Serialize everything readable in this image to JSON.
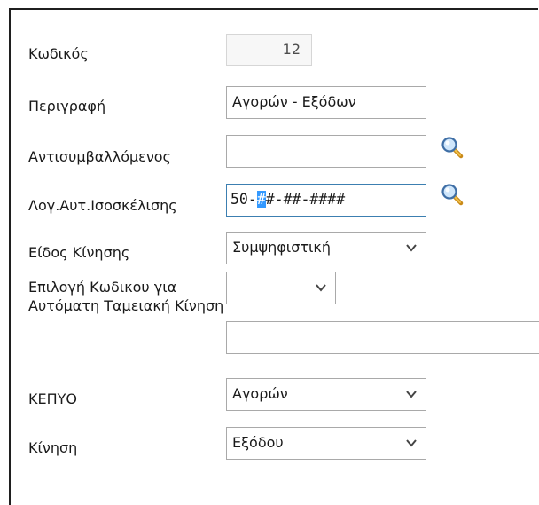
{
  "form": {
    "code_label": "Κωδικός",
    "code_value": "12",
    "description_label": "Περιγραφή",
    "description_value": "Αγορών - Εξόδων",
    "counterparty_label": "Αντισυμβαλλόμενος",
    "counterparty_value": "",
    "balancing_label": "Λογ.Αυτ.Ισοσκέλισης",
    "balancing_prefix": "50-",
    "balancing_selected": "#",
    "balancing_rest": "#-##-####",
    "movement_type_label": "Είδος Κίνησης",
    "movement_type_value": "Συμψηφιστική",
    "auto_code_label": "Επιλογή Κωδικου για Αυτόματη Ταμειακή Κίνηση",
    "auto_code_value": "",
    "auto_code_text": "",
    "kepyo_label": "ΚΕΠΥΟ",
    "kepyo_value": "Αγορών",
    "movement_label": "Κίνηση",
    "movement_value": "Εξόδου"
  },
  "icons": {
    "lookup": "magnifier-icon",
    "dropdown": "chevron-down-icon"
  },
  "colors": {
    "focus_border": "#3c7fb1",
    "selection": "#3399ff"
  }
}
